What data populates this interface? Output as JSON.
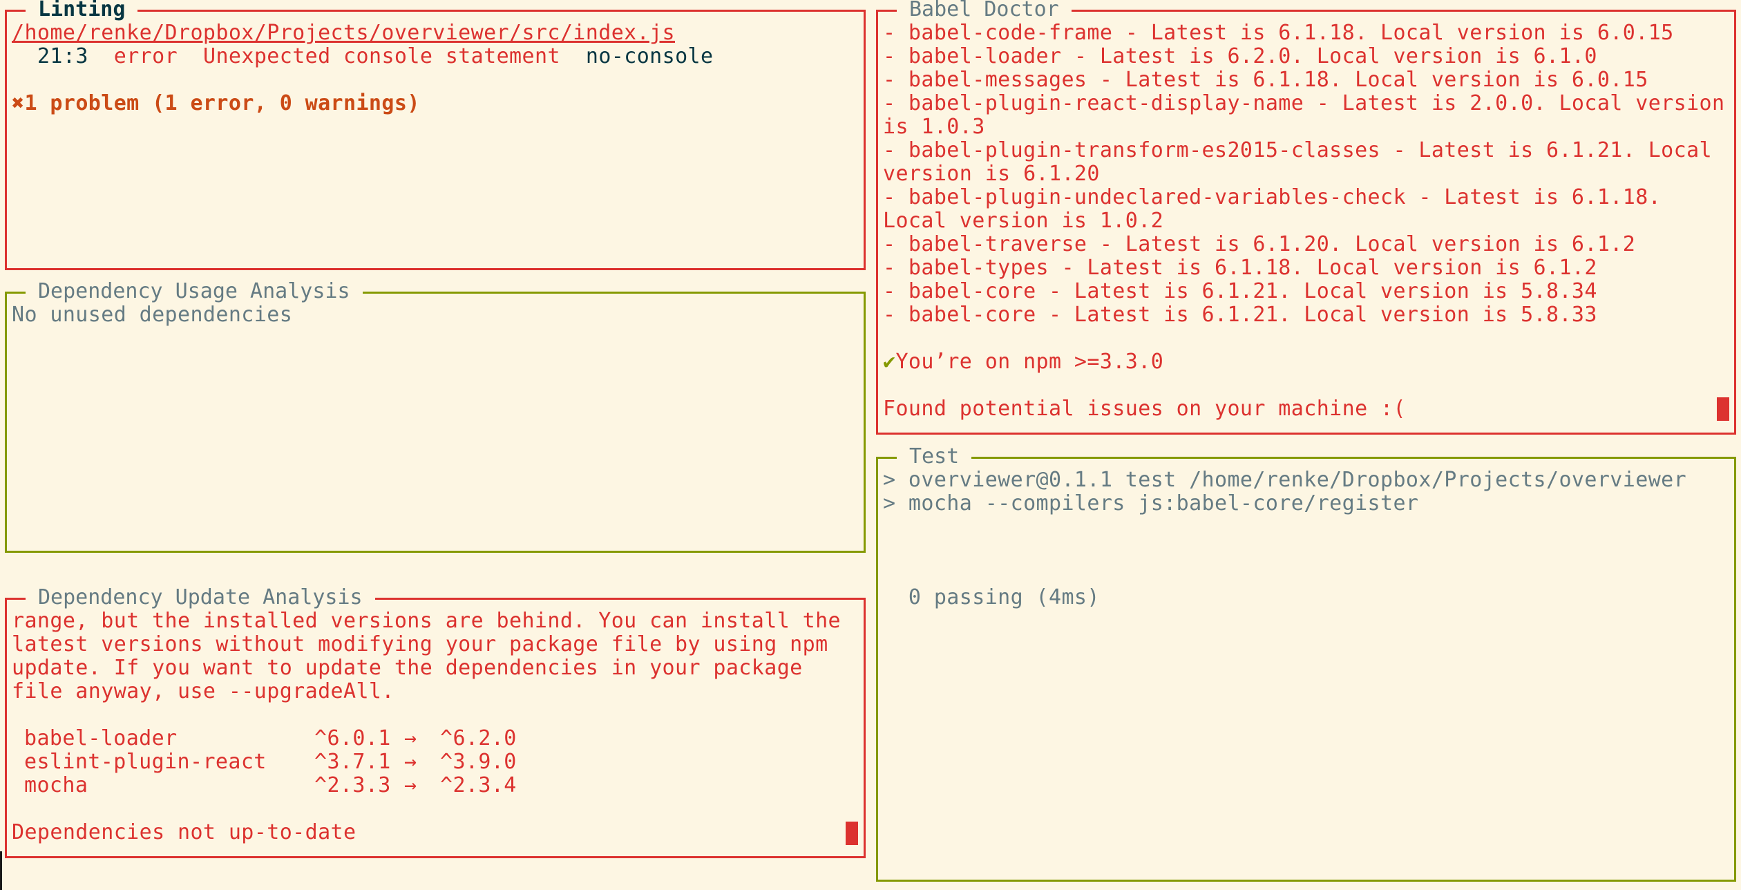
{
  "colors": {
    "background": "#fdf6e3",
    "text": "#657b83",
    "dark_text": "#073642",
    "error_red": "#dc322f",
    "warning_orange": "#cb4b16",
    "success_green": "#859900"
  },
  "linting": {
    "title": "Linting",
    "file_path": "/home/renke/Dropbox/Projects/overviewer/src/index.js",
    "issues": [
      {
        "location": "21:3",
        "severity": "error",
        "message": "Unexpected console statement",
        "rule": "no-console"
      }
    ],
    "summary_icon": "cross-icon",
    "summary_glyph": "✖",
    "summary": "1 problem (1 error, 0 warnings)"
  },
  "dependency_usage": {
    "title": "Dependency Usage Analysis",
    "message": "No unused dependencies"
  },
  "dependency_update": {
    "title": "Dependency Update Analysis",
    "description_lines": [
      "range, but the installed versions are behind. You can install the",
      "latest versions without modifying your package file by using npm",
      "update. If you want to update the dependencies in your package",
      "file anyway, use --upgradeAll."
    ],
    "packages": [
      {
        "name": "babel-loader",
        "current": "^6.0.1",
        "arrow": "→",
        "latest": "^6.2.0"
      },
      {
        "name": "eslint-plugin-react",
        "current": "^3.7.1",
        "arrow": "→",
        "latest": "^3.9.0"
      },
      {
        "name": "mocha",
        "current": "^2.3.3",
        "arrow": "→",
        "latest": "^2.3.4"
      }
    ],
    "status": "Dependencies not up-to-date"
  },
  "babel_doctor": {
    "title": "Babel Doctor",
    "lines": [
      "- babel-code-frame - Latest is 6.1.18. Local version is 6.0.15",
      "- babel-loader - Latest is 6.2.0. Local version is 6.1.0",
      "- babel-messages - Latest is 6.1.18. Local version is 6.0.15",
      "- babel-plugin-react-display-name - Latest is 2.0.0. Local version",
      "is 1.0.3",
      "- babel-plugin-transform-es2015-classes - Latest is 6.1.21. Local",
      "version is 6.1.20",
      "- babel-plugin-undeclared-variables-check - Latest is 6.1.18.",
      "Local version is 1.0.2",
      "- babel-traverse - Latest is 6.1.20. Local version is 6.1.2",
      "- babel-types - Latest is 6.1.18. Local version is 6.1.2",
      "- babel-core - Latest is 6.1.21. Local version is 5.8.34",
      "- babel-core - Latest is 6.1.21. Local version is 5.8.33"
    ],
    "npm_check_icon": "checkmark-icon",
    "npm_check_glyph": "✔",
    "npm_check": "You’re on npm >=3.3.0",
    "result": "Found potential issues on your machine :("
  },
  "test": {
    "title": "Test",
    "lines": [
      "> overviewer@0.1.1 test /home/renke/Dropbox/Projects/overviewer",
      "> mocha --compilers js:babel-core/register"
    ],
    "result": "  0 passing (4ms)"
  }
}
